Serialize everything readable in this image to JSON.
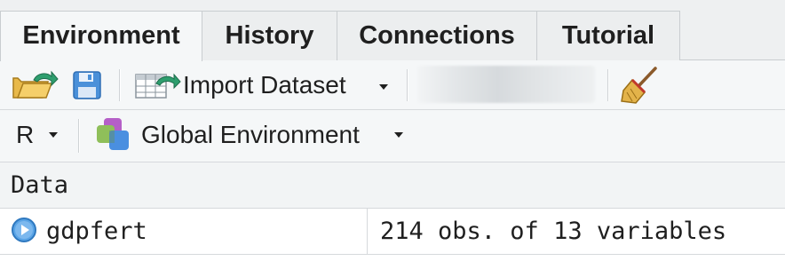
{
  "tabs": [
    {
      "label": "Environment",
      "active": true
    },
    {
      "label": "History",
      "active": false
    },
    {
      "label": "Connections",
      "active": false
    },
    {
      "label": "Tutorial",
      "active": false
    }
  ],
  "toolbar": {
    "open_icon": "open-folder-icon",
    "save_icon": "save-disk-icon",
    "import_icon": "import-table-icon",
    "import_label": "Import Dataset",
    "broom_icon": "broom-icon",
    "blurred_field": "memory-usage-indicator"
  },
  "env_toolbar": {
    "language": "R",
    "environment_label": "Global Environment",
    "environment_icon": "environment-layers-icon"
  },
  "section": {
    "title": "Data"
  },
  "rows": [
    {
      "name": "gdpfert",
      "value": "214 obs. of 13 variables",
      "icon": "expand-play-icon"
    }
  ],
  "colors": {
    "accent_blue": "#3a8fd6",
    "arrow_green": "#2e9e6e",
    "tab_bg": "#eceeef",
    "toolbar_bg": "#f5f7f8"
  }
}
